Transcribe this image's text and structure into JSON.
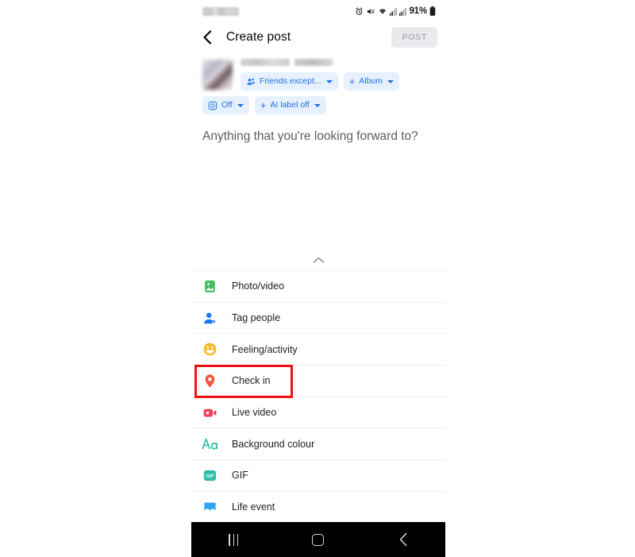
{
  "status_bar": {
    "left_blurred_label": "",
    "icons": [
      "alarm-icon",
      "mute-icon",
      "wifi-icon",
      "signal-icon",
      "signal-icon"
    ],
    "battery_text": "91%",
    "battery_icon": "battery-icon"
  },
  "app_bar": {
    "back_icon": "chevron-left-icon",
    "title": "Create post",
    "post_label": "POST",
    "post_enabled": false
  },
  "composer": {
    "avatar": "user-avatar-blurred",
    "name_blurred": true,
    "placeholder": "Anything that you're looking forward to?",
    "chips_row_1": [
      {
        "icon": "friends-icon",
        "label": "Friends except...",
        "has_plus": false,
        "has_caret": true
      },
      {
        "icon": "",
        "label": "Album",
        "has_plus": true,
        "has_caret": true
      }
    ],
    "chips_row_2": [
      {
        "icon": "camera-square-icon",
        "label": "Off",
        "has_plus": false,
        "has_caret": true
      },
      {
        "icon": "",
        "label": "AI label off",
        "has_plus": true,
        "has_caret": true
      }
    ],
    "collapse_icon": "chevron-up-icon"
  },
  "options": [
    {
      "icon": "photo-video-icon",
      "label": "Photo/video",
      "color": "#45bd62",
      "highlighted": false
    },
    {
      "icon": "tag-people-icon",
      "label": "Tag people",
      "color": "#1877f2",
      "highlighted": false
    },
    {
      "icon": "feeling-activity-icon",
      "label": "Feeling/activity",
      "color": "#f7b928",
      "highlighted": false
    },
    {
      "icon": "check-in-icon",
      "label": "Check in",
      "color": "#f5533d",
      "highlighted": true
    },
    {
      "icon": "live-video-icon",
      "label": "Live video",
      "color": "#f3425f",
      "highlighted": false
    },
    {
      "icon": "background-colour-icon",
      "label": "Background colour",
      "color": "#2abba7",
      "highlighted": false
    },
    {
      "icon": "gif-icon",
      "label": "GIF",
      "color": "#2abba7",
      "highlighted": false
    },
    {
      "icon": "life-event-icon",
      "label": "Life event",
      "color": "#2aa4f4",
      "highlighted": false
    }
  ],
  "annotation": {
    "target": "Check in",
    "color": "#ee1111"
  },
  "nav_bar": {
    "recents_icon": "recents-icon",
    "home_icon": "home-icon",
    "back_icon": "back-chevron-icon"
  },
  "colors": {
    "chip_bg": "#e7f0fd",
    "chip_text": "#1b74e4",
    "accent": "#1877f2",
    "annotation": "#ee1111",
    "divider": "#eceef0"
  }
}
